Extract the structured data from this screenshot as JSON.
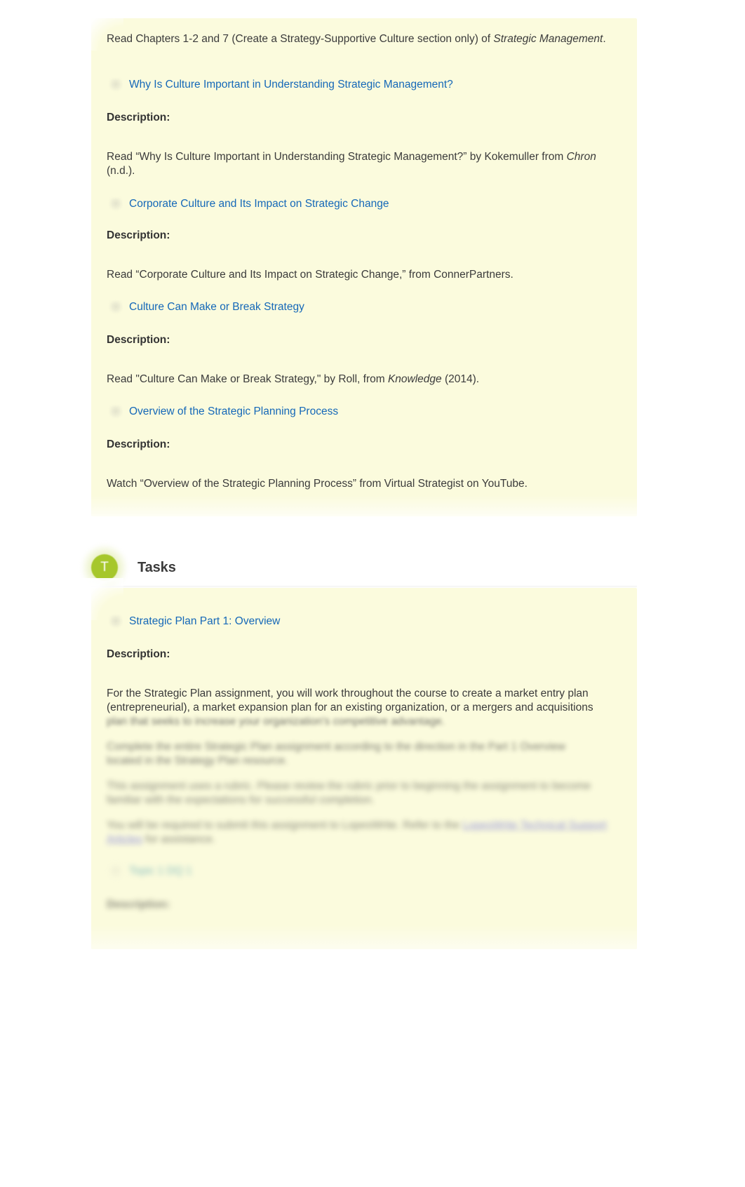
{
  "page": {
    "background_color": "#ffffff",
    "card_background_color": "#fbfbdd",
    "link_color": "#1568b8",
    "accent_color": "#a6c72b"
  },
  "resources_card": {
    "intro": {
      "text_before_italic": "Read Chapters 1-2 and 7 (Create a Strategy-Supportive Culture section only) of ",
      "italic": "Strategic Management",
      "text_after_italic": "."
    },
    "items": [
      {
        "icon": "resource-link-icon",
        "link_label": "Why Is Culture Important in Understanding Strategic Management?",
        "description_label": "Description:",
        "description_before_italic": "Read “Why Is Culture Important in Understanding Strategic Management?” by Kokemuller from ",
        "description_italic": "Chron",
        "description_after_italic": " (n.d.)."
      },
      {
        "icon": "resource-link-icon",
        "link_label": "Corporate Culture and Its Impact on Strategic Change",
        "description_label": "Description:",
        "description_before_italic": "Read “Corporate Culture and Its Impact on Strategic Change,” from ConnerPartners.",
        "description_italic": "",
        "description_after_italic": ""
      },
      {
        "icon": "resource-link-icon",
        "link_label": "Culture Can Make or Break Strategy",
        "description_label": "Description:",
        "description_before_italic": "Read \"Culture Can Make or Break Strategy,\" by Roll, from ",
        "description_italic": "Knowledge",
        "description_after_italic": " (2014)."
      },
      {
        "icon": "resource-link-icon",
        "link_label": "Overview of the Strategic Planning Process",
        "description_label": "Description:",
        "description_before_italic": "Watch “Overview of the Strategic Planning Process” from Virtual Strategist on YouTube.",
        "description_italic": "",
        "description_after_italic": ""
      }
    ]
  },
  "tasks_section": {
    "badge_letter": "T",
    "title": "Tasks",
    "badge_color": "#a6c72b"
  },
  "tasks_card": {
    "items": [
      {
        "icon": "task-link-icon",
        "link_label": "Strategic Plan Part 1: Overview",
        "description_label": "Description:",
        "description_line_1": "For the Strategic Plan assignment, you will work throughout the course to create a market entry plan",
        "description_line_2": "(entrepreneurial), a market expansion plan for an existing organization, or a mergers and acquisitions",
        "description_line_3_blurred": "plan that seeks to increase your organization's competitive advantage."
      }
    ],
    "blurred_paragraphs": [
      {
        "line_1": "Complete the entire Strategic Plan assignment according to the direction in the Part 1 Overview",
        "line_2": "located in the Strategy Plan resource."
      },
      {
        "line_1": "This assignment uses a rubric. Please review the rubric prior to beginning the assignment to become",
        "line_2": "familiar with the expectations for successful completion."
      },
      {
        "line_1_before_link": "You will be required to submit this assignment to LopesWrite. Refer to the ",
        "link_text": "LopesWrite Technical Support Articles",
        "line_1_after_link": " for assistance."
      }
    ],
    "blurred_second_item": {
      "icon": "task-link-icon",
      "link_label": "Topic 1 DQ 1",
      "description_label": "Description:"
    }
  }
}
